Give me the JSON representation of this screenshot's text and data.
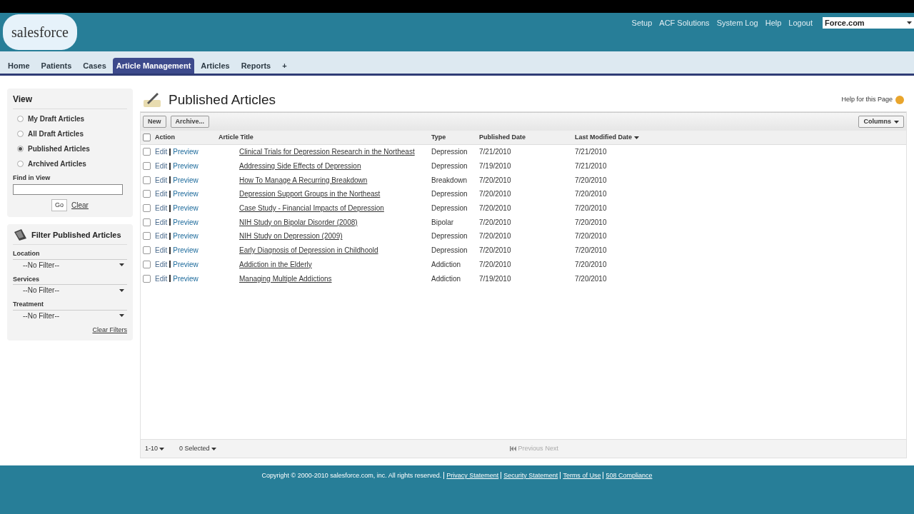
{
  "header": {
    "logo": "salesforce",
    "links": [
      "Setup",
      "ACF Solutions",
      "System Log",
      "Help",
      "Logout"
    ],
    "app_select": "Force.com"
  },
  "tabs": [
    {
      "label": "Home",
      "selected": false
    },
    {
      "label": "Patients",
      "selected": false
    },
    {
      "label": "Cases",
      "selected": false
    },
    {
      "label": "Article Management",
      "selected": true
    },
    {
      "label": "Articles",
      "selected": false
    },
    {
      "label": "Reports",
      "selected": false
    },
    {
      "label": "+",
      "selected": false
    }
  ],
  "view": {
    "title": "View",
    "options": [
      {
        "label": "My Draft Articles",
        "selected": false
      },
      {
        "label": "All Draft Articles",
        "selected": false
      },
      {
        "label": "Published Articles",
        "selected": true
      },
      {
        "label": "Archived Articles",
        "selected": false
      }
    ],
    "find_label": "Find in View",
    "go": "Go",
    "clear": "Clear"
  },
  "filter": {
    "title": "Filter Published Articles",
    "filters": [
      {
        "label": "Location",
        "value": "--No Filter--"
      },
      {
        "label": "Services",
        "value": "--No Filter--"
      },
      {
        "label": "Treatment",
        "value": "--No Filter--"
      }
    ],
    "clear": "Clear Filters"
  },
  "main": {
    "title": "Published Articles",
    "help": "Help for this Page",
    "buttons": [
      "New",
      "Archive..."
    ],
    "columns_button": "Columns",
    "all_checked": false,
    "columns": [
      "Action",
      "Article Title",
      "Type",
      "Published Date",
      "Last Modified Date"
    ],
    "rows": [
      {
        "checked": false,
        "edit": "Edit",
        "preview": "Preview",
        "title": "Clinical Trials for Depression Research in the Northeast",
        "type": "Depression",
        "published": "7/21/2010",
        "modified": "7/21/2010"
      },
      {
        "checked": false,
        "edit": "Edit",
        "preview": "Preview",
        "title": "Addressing Side Effects of Depression",
        "type": "Depression",
        "published": "7/19/2010",
        "modified": "7/21/2010"
      },
      {
        "checked": false,
        "edit": "Edit",
        "preview": "Preview",
        "title": "How To Manage A Recurring Breakdown",
        "type": "Breakdown",
        "published": "7/20/2010",
        "modified": "7/20/2010"
      },
      {
        "checked": false,
        "edit": "Edit",
        "preview": "Preview",
        "title": "Depression Support Groups in the Northeast",
        "type": "Depression",
        "published": "7/20/2010",
        "modified": "7/20/2010"
      },
      {
        "checked": false,
        "edit": "Edit",
        "preview": "Preview",
        "title": "Case Study - Financial Impacts of Depression",
        "type": "Depression",
        "published": "7/20/2010",
        "modified": "7/20/2010"
      },
      {
        "checked": false,
        "edit": "Edit",
        "preview": "Preview",
        "title": "NIH Study on Bipolar Disorder (2008)",
        "type": "Bipolar",
        "published": "7/20/2010",
        "modified": "7/20/2010"
      },
      {
        "checked": false,
        "edit": "Edit",
        "preview": "Preview",
        "title": "NIH Study on Depression (2009)",
        "type": "Depression",
        "published": "7/20/2010",
        "modified": "7/20/2010"
      },
      {
        "checked": false,
        "edit": "Edit",
        "preview": "Preview",
        "title": "Early Diagnosis of Depression in Childhoold",
        "type": "Depression",
        "published": "7/20/2010",
        "modified": "7/20/2010"
      },
      {
        "checked": false,
        "edit": "Edit",
        "preview": "Preview",
        "title": "Addiction in the Elderly",
        "type": "Addiction",
        "published": "7/20/2010",
        "modified": "7/20/2010"
      },
      {
        "checked": false,
        "edit": "Edit",
        "preview": "Preview",
        "title": "Managing Multiple Addictions",
        "type": "Addiction",
        "published": "7/19/2010",
        "modified": "7/20/2010"
      }
    ],
    "pager": {
      "range": "1-10",
      "selected": "0 Selected",
      "previous": "Previous",
      "next": "Next"
    }
  },
  "footer": {
    "copyright": "Copyright © 2000-2010 salesforce.com, inc. All rights reserved.",
    "links": [
      "Privacy Statement",
      "Security Statement",
      "Terms of Use",
      "508 Compliance"
    ]
  }
}
